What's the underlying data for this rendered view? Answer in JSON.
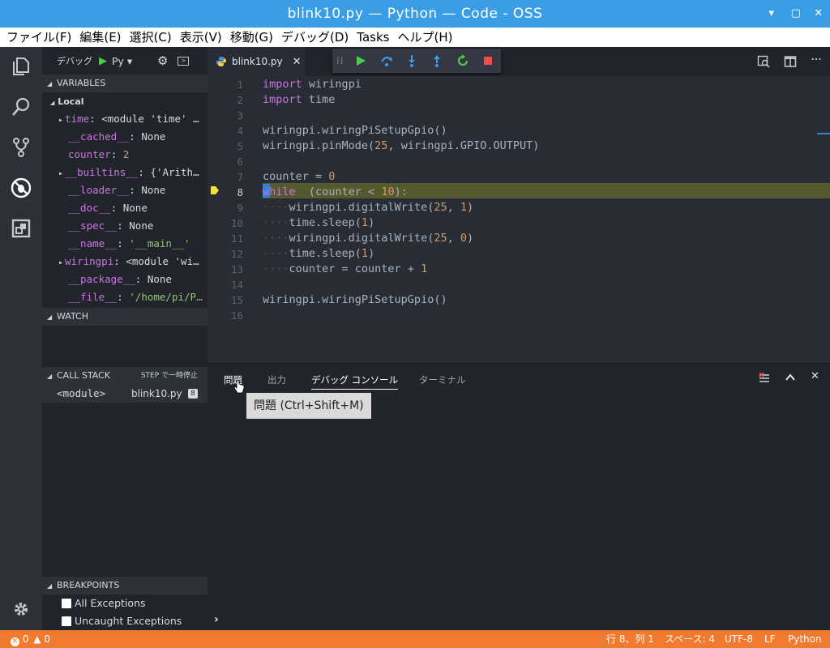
{
  "window": {
    "title": "blink10.py — Python — Code - OSS"
  },
  "menu": [
    "ファイル(F)",
    "編集(E)",
    "選択(C)",
    "表示(V)",
    "移動(G)",
    "デバッグ(D)",
    "Tasks",
    "ヘルプ(H)"
  ],
  "sidebar": {
    "debug_label": "デバッグ",
    "config": "Py",
    "variables_title": "VARIABLES",
    "local_label": "Local",
    "variables": [
      {
        "name": "time",
        "value": "<module 'time' …",
        "expandable": true
      },
      {
        "name": "__cached__",
        "value": "None",
        "expandable": false
      },
      {
        "name": "counter",
        "value": "2",
        "expandable": false
      },
      {
        "name": "__builtins__",
        "value": "{'Arith…",
        "expandable": true
      },
      {
        "name": "__loader__",
        "value": "None",
        "expandable": false
      },
      {
        "name": "__doc__",
        "value": "None",
        "expandable": false
      },
      {
        "name": "__spec__",
        "value": "None",
        "expandable": false
      },
      {
        "name": "__name__",
        "value": "'__main__'",
        "expandable": false
      },
      {
        "name": "wiringpi",
        "value": "<module 'wi…",
        "expandable": true
      },
      {
        "name": "__package__",
        "value": "None",
        "expandable": false
      },
      {
        "name": "__file__",
        "value": "'/home/pi/P…",
        "expandable": false
      }
    ],
    "watch_title": "WATCH",
    "callstack_title": "CALL STACK",
    "callstack_status": "STEP で一時停止",
    "callstack_frame": "<module>",
    "callstack_file": "blink10.py",
    "callstack_line": "8",
    "breakpoints_title": "BREAKPOINTS",
    "breakpoints": [
      "All Exceptions",
      "Uncaught Exceptions"
    ]
  },
  "editor": {
    "tab_label": "blink10.py",
    "current_line": 8,
    "lines": [
      {
        "n": "1",
        "tokens": [
          [
            "kw",
            "import"
          ],
          [
            "",
            "wiringpi"
          ]
        ]
      },
      {
        "n": "2",
        "tokens": [
          [
            "kw",
            "import"
          ],
          [
            "",
            "time"
          ]
        ]
      },
      {
        "n": "3",
        "tokens": []
      },
      {
        "n": "4",
        "tokens": [
          [
            "",
            "wiringpi.wiringPiSetupGpio()"
          ]
        ]
      },
      {
        "n": "5",
        "tokens": [
          [
            "",
            "wiringpi.pinMode("
          ],
          [
            "num",
            "25"
          ],
          [
            "",
            ", wiringpi.GPIO.OUTPUT)"
          ]
        ]
      },
      {
        "n": "6",
        "tokens": []
      },
      {
        "n": "7",
        "tokens": [
          [
            "",
            "counter = "
          ],
          [
            "num",
            "0"
          ]
        ]
      },
      {
        "n": "8",
        "tokens": [
          [
            "kw",
            "while"
          ],
          [
            "",
            " (counter < "
          ],
          [
            "num",
            "10"
          ],
          [
            "",
            "):"
          ]
        ]
      },
      {
        "n": "9",
        "tokens": [
          [
            "ws",
            "····"
          ],
          [
            "",
            "wiringpi.digitalWrite("
          ],
          [
            "num",
            "25"
          ],
          [
            "",
            ", "
          ],
          [
            "num",
            "1"
          ],
          [
            "",
            ")"
          ]
        ]
      },
      {
        "n": "10",
        "tokens": [
          [
            "ws",
            "····"
          ],
          [
            "",
            "time.sleep("
          ],
          [
            "num",
            "1"
          ],
          [
            "",
            ")"
          ]
        ]
      },
      {
        "n": "11",
        "tokens": [
          [
            "ws",
            "····"
          ],
          [
            "",
            "wiringpi.digitalWrite("
          ],
          [
            "num",
            "25"
          ],
          [
            "",
            ", "
          ],
          [
            "num",
            "0"
          ],
          [
            "",
            ")"
          ]
        ]
      },
      {
        "n": "12",
        "tokens": [
          [
            "ws",
            "····"
          ],
          [
            "",
            "time.sleep("
          ],
          [
            "num",
            "1"
          ],
          [
            "",
            ")"
          ]
        ]
      },
      {
        "n": "13",
        "tokens": [
          [
            "ws",
            "····"
          ],
          [
            "",
            "counter = counter + "
          ],
          [
            "num",
            "1"
          ]
        ]
      },
      {
        "n": "14",
        "tokens": []
      },
      {
        "n": "15",
        "tokens": [
          [
            "",
            "wiringpi.wiringPiSetupGpio()"
          ]
        ]
      },
      {
        "n": "16",
        "tokens": []
      }
    ]
  },
  "panel": {
    "tabs": [
      "問題",
      "出力",
      "デバッグ コンソール",
      "ターミナル"
    ],
    "active_tab": "デバッグ コンソール",
    "tooltip": "問題 (Ctrl+Shift+M)",
    "prompt": "›"
  },
  "status": {
    "errors": "0",
    "warnings": "0",
    "position": "行 8、列 1",
    "spaces": "スペース: 4",
    "encoding": "UTF-8",
    "eol": "LF",
    "language": "Python"
  },
  "colors": {
    "titlebar": "#3a9ee6",
    "statusbar": "#f17a31",
    "current_line": "#545a2e"
  }
}
